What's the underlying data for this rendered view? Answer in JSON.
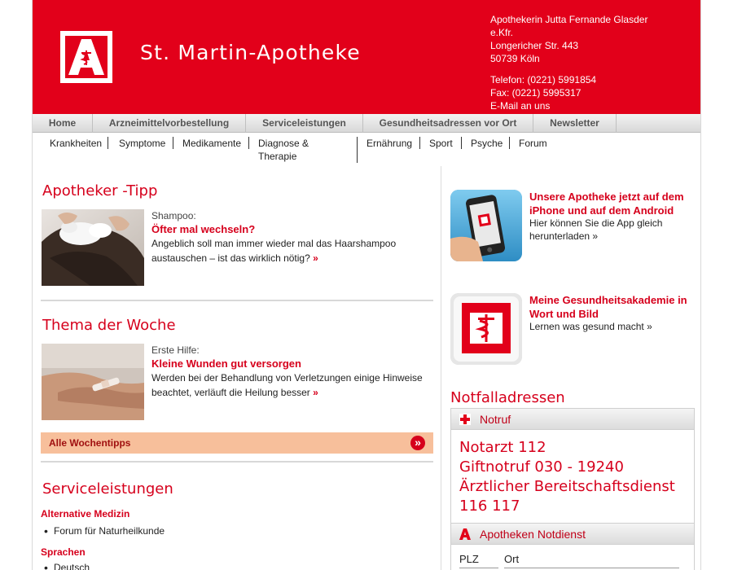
{
  "header": {
    "site_title": "St. Martin-Apotheke",
    "owner": "Apothekerin Jutta Fernande Glasder",
    "legal_form": "e.Kfr.",
    "street": "Longericher Str. 443",
    "city": "50739 Köln",
    "phone": "Telefon: (0221) 5991854",
    "fax": "Fax: (0221) 5995317",
    "email_link": "E-Mail an uns",
    "brand_color": "#e2001a"
  },
  "main_nav": [
    {
      "label": "Home"
    },
    {
      "label": "Arzneimittelvorbestellung"
    },
    {
      "label": "Serviceleistungen"
    },
    {
      "label": "Gesundheitsadressen vor Ort"
    },
    {
      "label": "Newsletter"
    }
  ],
  "sub_nav": [
    {
      "label": "Krankheiten"
    },
    {
      "label": "Symptome"
    },
    {
      "label": "Medikamente"
    },
    {
      "label": "Diagnose &\nTherapie"
    },
    {
      "label": "Ernährung"
    },
    {
      "label": "Sport"
    },
    {
      "label": "Psyche"
    },
    {
      "label": "Forum"
    }
  ],
  "tipp": {
    "heading": "Apotheker -Tipp",
    "label": "Shampoo:",
    "title": "Öfter mal wechseln?",
    "text": "Angeblich soll man immer wieder mal das Haarshampoo austauschen – ist das wirklich nötig?",
    "more": "»"
  },
  "thema": {
    "heading": "Thema der Woche",
    "label": "Erste Hilfe:",
    "title": "Kleine Wunden gut versorgen",
    "text": "Werden bei der Behandlung von Verletzungen einige Hinweise beachtet, verläuft die Heilung besser",
    "more": "»"
  },
  "all_tips_button": "Alle Wochentipps",
  "all_tips_arrow": "»",
  "services": {
    "heading": "Serviceleistungen",
    "categories": [
      {
        "name": "Alternative Medizin",
        "items": [
          "Forum für Naturheilkunde"
        ]
      },
      {
        "name": "Sprachen",
        "items": [
          "Deutsch"
        ]
      }
    ]
  },
  "promos": [
    {
      "title": "Unsere Apotheke jetzt auf dem iPhone und auf dem Android",
      "text": "Hier können Sie die App gleich herunterladen »",
      "icon": "smartphone-app-icon"
    },
    {
      "title": "Meine Gesundheitsakademie in Wort und Bild",
      "text": "Lernen was gesund macht »",
      "icon": "apotheke-a-icon"
    }
  ],
  "emergency": {
    "heading": "Notfalladressen",
    "notruf_title": "Notruf",
    "lines": [
      "Notarzt 112",
      "Giftnotruf 030 - 19240",
      "Ärztlicher Bereitschaftsdienst",
      "116 117"
    ],
    "notdienst_title": "Apotheken Notdienst",
    "plz_label": "PLZ",
    "ort_label": "Ort"
  }
}
